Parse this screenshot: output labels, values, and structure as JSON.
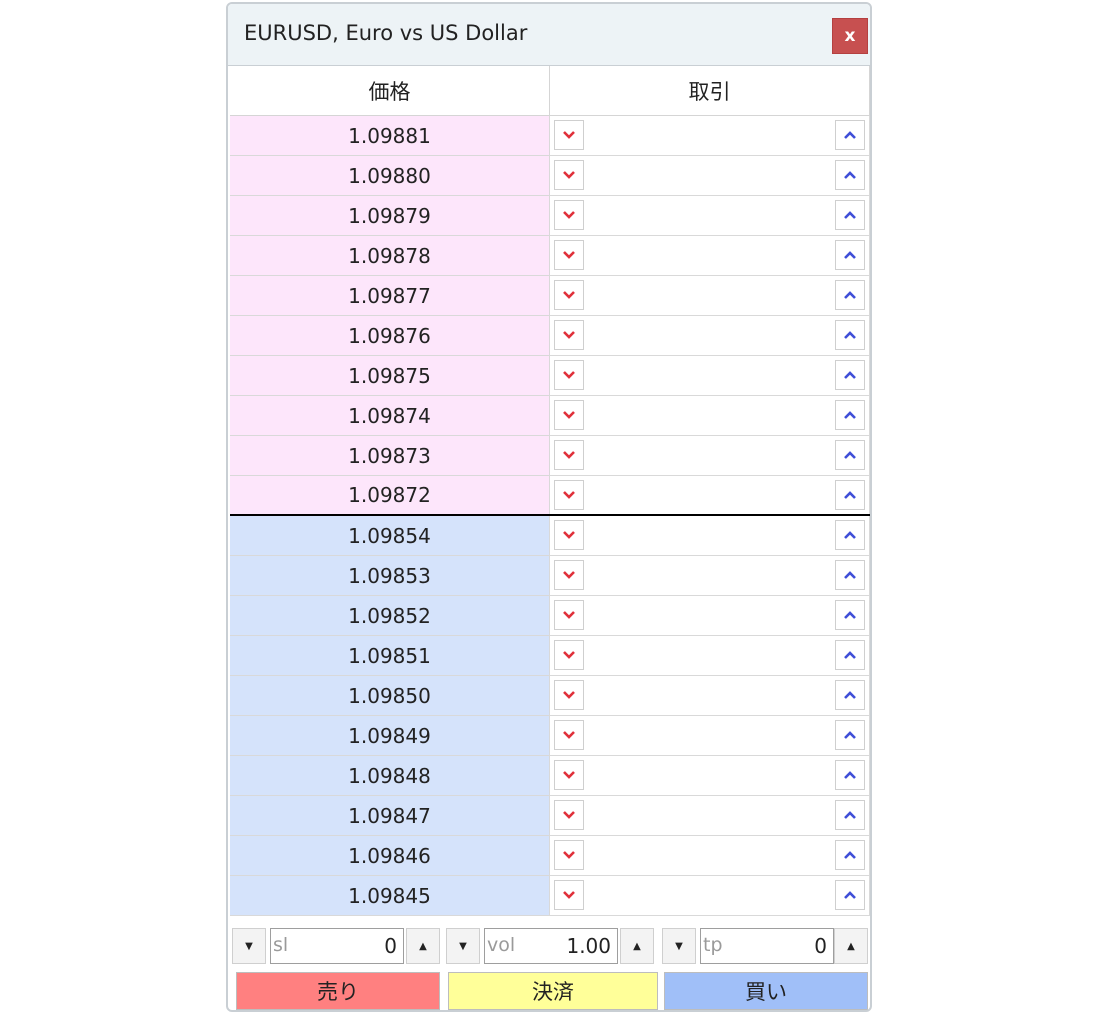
{
  "window": {
    "title": "EURUSD, Euro vs US Dollar",
    "close_label": "x"
  },
  "header": {
    "price_label": "価格",
    "trade_label": "取引"
  },
  "ask_prices": [
    "1.09881",
    "1.09880",
    "1.09879",
    "1.09878",
    "1.09877",
    "1.09876",
    "1.09875",
    "1.09874",
    "1.09873",
    "1.09872"
  ],
  "bid_prices": [
    "1.09854",
    "1.09853",
    "1.09852",
    "1.09851",
    "1.09850",
    "1.09849",
    "1.09848",
    "1.09847",
    "1.09846",
    "1.09845"
  ],
  "controls": {
    "sl": {
      "label": "sl",
      "value": "0"
    },
    "vol": {
      "label": "vol",
      "value": "1.00"
    },
    "tp": {
      "label": "tp",
      "value": "0"
    }
  },
  "actions": {
    "sell_label": "売り",
    "close_label": "決済",
    "buy_label": "買い"
  },
  "icons": {
    "sell": "chevron-down-icon",
    "buy": "chevron-up-icon",
    "decrement": "triangle-down-icon",
    "increment": "triangle-up-icon"
  },
  "colors": {
    "ask_bg": "#fde6fb",
    "bid_bg": "#d5e3fb",
    "sell_icon": "#e0303a",
    "buy_icon": "#3f4fd8",
    "sell_btn": "#ff8080",
    "close_btn": "#ffff99",
    "buy_btn": "#a0bff8",
    "close_x": "#c75050"
  }
}
